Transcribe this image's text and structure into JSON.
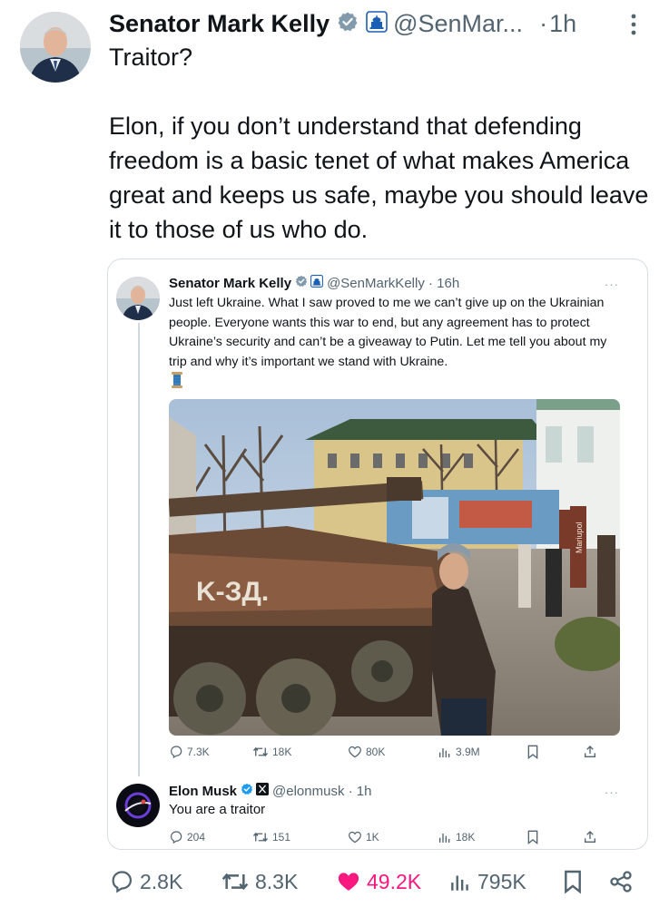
{
  "main_tweet": {
    "author_name": "Senator Mark Kelly",
    "handle": "@SenMar...",
    "time": "1h",
    "separator": "·",
    "text_line1": "Traitor?",
    "text_paragraph": "Elon, if you don’t understand that defending freedom is a basic tenet of what makes America great and keeps us safe, maybe you should leave it to those of us who do.",
    "stats": {
      "replies": "2.8K",
      "reposts": "8.3K",
      "likes": "49.2K",
      "views": "795K"
    }
  },
  "quoted_tweet": {
    "author_name": "Senator Mark Kelly",
    "handle_time": "@SenMarkKelly · 16h",
    "more": "···",
    "text": "Just left Ukraine. What I saw proved to me we can’t give up on the Ukrainian people. Everyone wants this war to end, but any agreement has to protect Ukraine’s security and can’t be a giveaway to Putin. Let me tell you about my trip and why it’s important we stand with Ukraine.",
    "photo_sign_text": "Mariupol",
    "stats": {
      "replies": "7.3K",
      "reposts": "18K",
      "likes": "80K",
      "views": "3.9M"
    }
  },
  "reply_tweet": {
    "author_name": "Elon Musk",
    "handle_time": "@elonmusk · 1h",
    "more": "···",
    "text": "You are a traitor",
    "stats": {
      "replies": "204",
      "reposts": "151",
      "likes": "1K",
      "views": "18K"
    }
  },
  "colors": {
    "verified_blue": "#1d9bf0",
    "gov_badge": "#829aab",
    "like_pink": "#f91880",
    "muted_text": "#536471"
  },
  "icons": [
    "verified-badge-icon",
    "government-badge-icon",
    "more-icon",
    "reply-icon",
    "repost-icon",
    "like-icon",
    "views-icon",
    "bookmark-icon",
    "share-icon",
    "x-logo-badge-icon",
    "thread-emoji-icon"
  ]
}
